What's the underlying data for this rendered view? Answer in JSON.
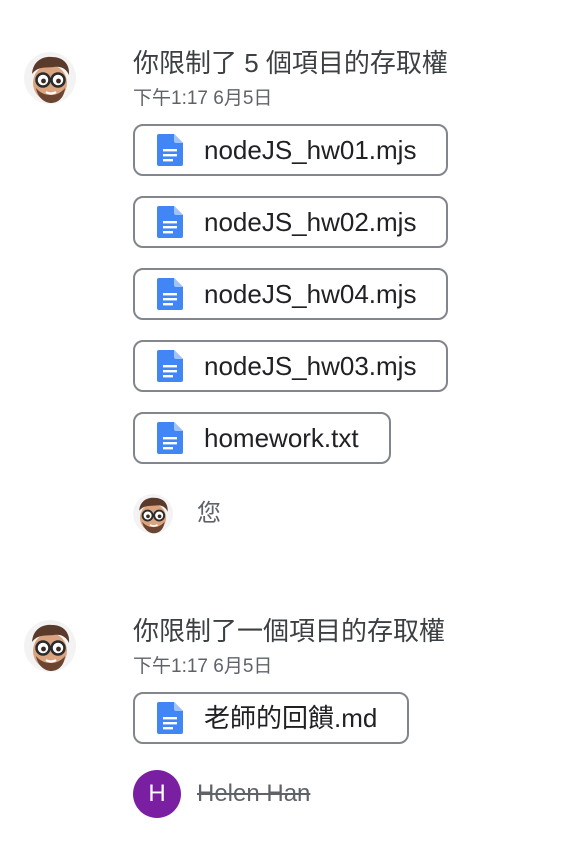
{
  "activities": [
    {
      "headline": "你限制了 5 個項目的存取權",
      "timestamp": "下午1:17 6月5日",
      "files": [
        {
          "name": "nodeJS_hw01.mjs",
          "icon": "google-docs-icon"
        },
        {
          "name": "nodeJS_hw02.mjs",
          "icon": "google-docs-icon"
        },
        {
          "name": "nodeJS_hw04.mjs",
          "icon": "google-docs-icon"
        },
        {
          "name": "nodeJS_hw03.mjs",
          "icon": "google-docs-icon"
        },
        {
          "name": "homework.txt",
          "icon": "google-docs-icon"
        }
      ],
      "actor": {
        "name": "您",
        "avatar": "memoji-avatar"
      }
    },
    {
      "headline": "你限制了一個項目的存取權",
      "timestamp": "下午1:17 6月5日",
      "files": [
        {
          "name": "老師的回饋.md",
          "icon": "google-docs-icon"
        }
      ],
      "actor": {
        "name": "Helen Han",
        "initial": "H",
        "avatar_color": "#7b1fa2",
        "struck": true
      }
    }
  ],
  "colors": {
    "doc_icon": "#4285f4",
    "chip_border": "#80868b",
    "secondary_text": "#5f6368"
  }
}
